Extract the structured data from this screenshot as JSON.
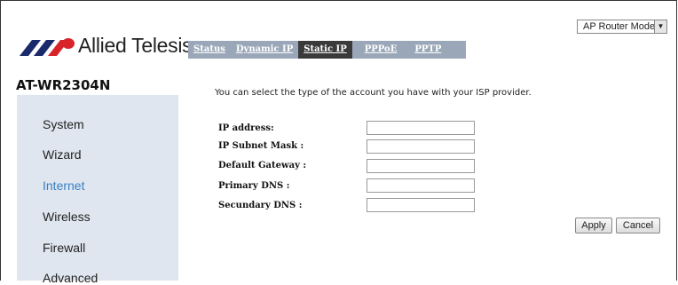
{
  "brand": {
    "name": "Allied Telesis",
    "model": "AT-WR2304N"
  },
  "mode_select": {
    "value": "AP Router Mode"
  },
  "tabs": [
    {
      "label": "Status"
    },
    {
      "label": "Dynamic IP"
    },
    {
      "label": "Static IP"
    },
    {
      "label": "PPPoE"
    },
    {
      "label": "PPTP"
    }
  ],
  "active_tab": "Static IP",
  "sidebar": {
    "items": [
      {
        "label": "System"
      },
      {
        "label": "Wizard"
      },
      {
        "label": "Internet"
      },
      {
        "label": "Wireless"
      },
      {
        "label": "Firewall"
      },
      {
        "label": "Advanced"
      }
    ],
    "active": "Internet"
  },
  "main": {
    "info": "You can select the type of the account you have with your ISP provider.",
    "fields": [
      {
        "label": "IP address:",
        "value": ""
      },
      {
        "label": "IP Subnet Mask :",
        "value": ""
      },
      {
        "label": "Default Gateway :",
        "value": ""
      },
      {
        "label": "Primary DNS :",
        "value": ""
      },
      {
        "label": "Secundary DNS :",
        "value": ""
      }
    ],
    "apply_label": "Apply",
    "cancel_label": "Cancel"
  },
  "colors": {
    "tab_bar": "#9aa7b8",
    "tab_active": "#3a3a3a",
    "sidebar_bg": "#dfe6ef",
    "active_link": "#3b7fc4",
    "logo_red": "#d8232a",
    "logo_navy": "#1b2a6b"
  }
}
